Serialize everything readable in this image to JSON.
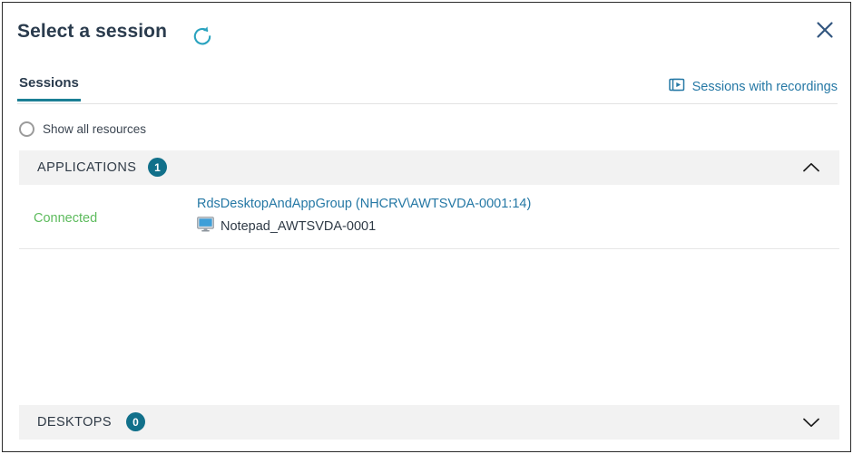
{
  "dialog": {
    "title": "Select a session",
    "refresh_icon": "refresh-icon",
    "close_icon": "close-icon"
  },
  "tabs": [
    {
      "label": "Sessions",
      "active": true
    }
  ],
  "recordings": {
    "label": "Sessions with recordings",
    "icon": "video-recording-icon",
    "color": "#2578a5"
  },
  "filter": {
    "show_all_resources_label": "Show all resources",
    "selected": false
  },
  "sections": [
    {
      "title": "APPLICATIONS",
      "count": "1",
      "expanded": true,
      "chevron": "chevron-up-icon"
    },
    {
      "title": "DESKTOPS",
      "count": "0",
      "expanded": false,
      "chevron": "chevron-down-icon"
    }
  ],
  "session": {
    "status": "Connected",
    "status_color": "#5dbb5d",
    "resource_link": "RdsDesktopAndAppGroup (NHCRV\\AWTSVDA-0001:14)",
    "app_name": "Notepad_AWTSVDA-0001",
    "app_icon": "monitor-icon"
  },
  "colors": {
    "accent": "#11708a",
    "link": "#2578a5",
    "tab_underline": "#1b7f95",
    "band_bg": "#f2f2f2"
  }
}
